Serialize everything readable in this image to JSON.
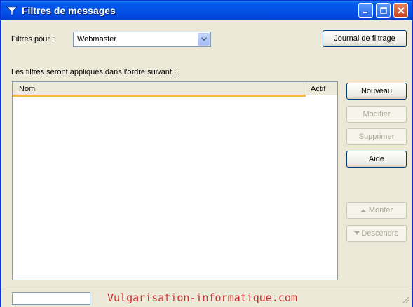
{
  "window": {
    "title": "Filtres de messages"
  },
  "toolbar": {
    "filter_for_label": "Filtres pour :",
    "account_selected": "Webmaster",
    "log_button": "Journal de filtrage"
  },
  "main": {
    "order_label": "Les filtres seront appliqués dans l'ordre suivant :",
    "columns": [
      "Nom",
      "Actif"
    ],
    "rows": []
  },
  "buttons": {
    "new": "Nouveau",
    "edit": "Modifier",
    "delete": "Supprimer",
    "help": "Aide",
    "up": "Monter",
    "down": "Descendre"
  },
  "status": {
    "watermark": "Vulgarisation-informatique.com"
  },
  "colors": {
    "titlebar": "#0653e6",
    "window_bg": "#ece9d8",
    "header_accent": "#f5b940",
    "watermark": "#c83232"
  }
}
